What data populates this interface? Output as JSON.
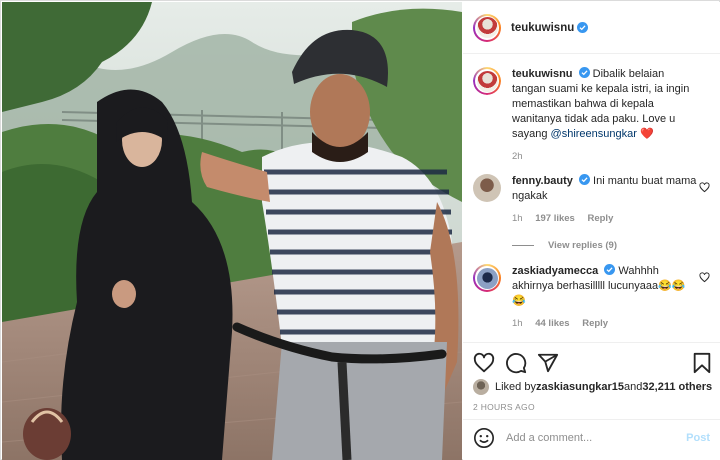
{
  "post": {
    "author": "teukuwisnu",
    "verified": true,
    "photo_alt": "",
    "caption": {
      "author": "teukuwisnu",
      "text": "Dibalik belaian tangan suami ke kepala istri, ia ingin memastikan bahwa di kepala wanitanya tidak ada paku. Love u sayang ",
      "mention": "@shireensungkar",
      "emoji": "❤️",
      "time": "2h"
    },
    "comments": [
      {
        "author": "fenny.bauty",
        "verified": true,
        "text": "Ini mantu buat mama ngakak",
        "time": "1h",
        "likes": "197 likes",
        "reply_label": "Reply",
        "view_replies": "View replies (9)"
      },
      {
        "author": "zaskiadyamecca",
        "verified": true,
        "text": "Wahhhh akhirnya berhasilllll lucunyaaa😂😂😂",
        "time": "1h",
        "likes": "44 likes",
        "reply_label": "Reply"
      }
    ],
    "liked_by_prefix": "Liked by ",
    "liked_by_user": "zaskiasungkar15",
    "liked_by_and": " and ",
    "liked_by_count": "32,211 others",
    "timestamp": "2 HOURS AGO",
    "add_comment_placeholder": "Add a comment...",
    "post_label": "Post"
  },
  "icons": {
    "like": "heart-icon",
    "comment": "comment-icon",
    "share": "send-icon",
    "save": "bookmark-icon",
    "emoji": "emoji-icon",
    "verified": "verified-badge-icon"
  },
  "colors": {
    "verified": "#3897f0",
    "link": "#00376b",
    "muted": "#8e8e8e",
    "post_disabled": "#b2dffc",
    "heart_red": "#ed4956"
  }
}
